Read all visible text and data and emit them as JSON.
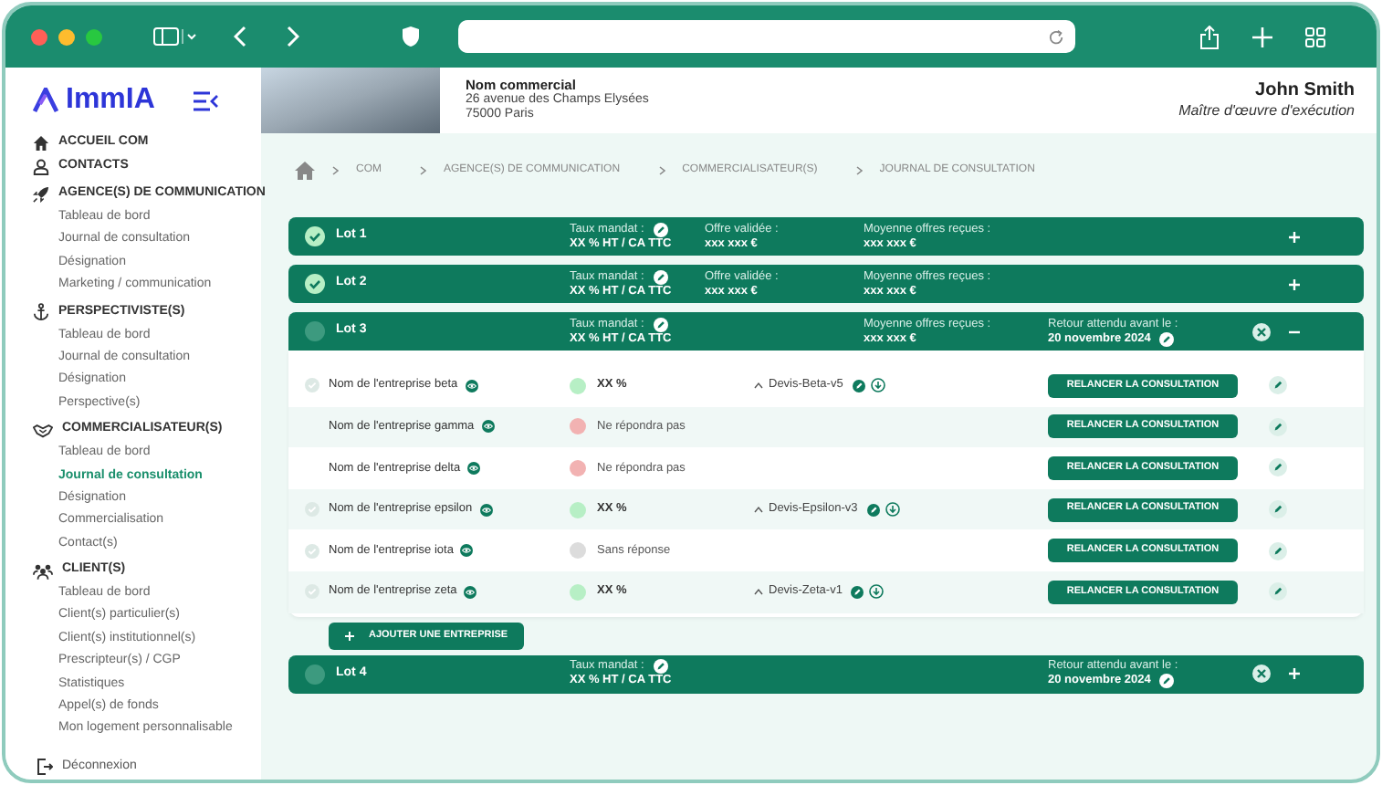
{
  "brand": {
    "name": "ImmIA"
  },
  "sidebar": {
    "sections": [
      {
        "kind": "home",
        "label": "ACCUEIL COM"
      },
      {
        "kind": "contacts",
        "label": "CONTACTS"
      },
      {
        "kind": "rocket",
        "label": "AGENCE(S) DE COMMUNICATION",
        "children": [
          {
            "label": "Tableau de bord",
            "selected": false
          },
          {
            "label": "Journal de consultation",
            "selected": false
          },
          {
            "label": "Désignation",
            "selected": false
          },
          {
            "label": "Marketing / communication",
            "selected": false
          }
        ]
      },
      {
        "kind": "anchor",
        "label": "PERSPECTIVISTE(S)",
        "children": [
          {
            "label": "Tableau de bord",
            "selected": false
          },
          {
            "label": "Journal de consultation",
            "selected": false
          },
          {
            "label": "Désignation",
            "selected": false
          },
          {
            "label": "Perspective(s)",
            "selected": false
          }
        ]
      },
      {
        "kind": "handshake",
        "label": "COMMERCIALISATEUR(S)",
        "children": [
          {
            "label": "Tableau de bord",
            "selected": false
          },
          {
            "label": "Journal de consultation",
            "selected": true
          },
          {
            "label": "Désignation",
            "selected": false
          },
          {
            "label": "Commercialisation",
            "selected": false
          },
          {
            "label": "Contact(s)",
            "selected": false
          }
        ]
      },
      {
        "kind": "people",
        "label": "CLIENT(S)",
        "children": [
          {
            "label": "Tableau de bord",
            "selected": false
          },
          {
            "label": "Client(s) particulier(s)",
            "selected": false
          },
          {
            "label": "Client(s) institutionnel(s)",
            "selected": false
          },
          {
            "label": "Prescripteur(s) / CGP",
            "selected": false
          },
          {
            "label": "Statistiques",
            "selected": false
          },
          {
            "label": "Appel(s) de fonds",
            "selected": false
          },
          {
            "label": "Mon logement personnalisable",
            "selected": false
          }
        ]
      }
    ],
    "logout": "Déconnexion"
  },
  "header": {
    "company": "Nom commercial",
    "address_lines": [
      "26 avenue des Champs Elysées",
      "75000 Paris"
    ],
    "user_name": "John Smith",
    "user_role": "Maître d'œuvre d'exécution"
  },
  "breadcrumb": [
    "COM",
    "AGENCE(S) DE COMMUNICATION",
    "COMMERCIALISATEUR(S)",
    "JOURNAL DE CONSULTATION"
  ],
  "lots": [
    {
      "name": "Lot 1",
      "completed": true,
      "expanded": false,
      "closable": false,
      "fields": {
        "taux_mandat": {
          "label": "Taux mandat :",
          "value": "XX % HT / CA TTC",
          "editable": true
        },
        "offre_validee": {
          "label": "Offre validée :",
          "value": "xxx xxx €",
          "editable": false
        },
        "moyenne_offres": {
          "label": "Moyenne offres reçues :",
          "value": "xxx xxx €",
          "editable": false
        }
      }
    },
    {
      "name": "Lot 2",
      "completed": true,
      "expanded": false,
      "closable": false,
      "fields": {
        "taux_mandat": {
          "label": "Taux mandat :",
          "value": "XX % HT / CA TTC",
          "editable": true
        },
        "offre_validee": {
          "label": "Offre validée :",
          "value": "xxx xxx €",
          "editable": false
        },
        "moyenne_offres": {
          "label": "Moyenne offres reçues :",
          "value": "xxx xxx €",
          "editable": false
        }
      }
    },
    {
      "name": "Lot 3",
      "completed": false,
      "expanded": true,
      "closable": true,
      "fields": {
        "taux_mandat": {
          "label": "Taux mandat :",
          "value": "XX % HT / CA TTC",
          "editable": true
        },
        "moyenne_offres": {
          "label": "Moyenne offres reçues :",
          "value": "xxx xxx €",
          "editable": false
        },
        "retour_attendu": {
          "label": "Retour attendu avant le :",
          "value": "20 novembre 2024",
          "editable": true
        }
      },
      "companies": [
        {
          "name": "Nom de l'entreprise beta",
          "checked": true,
          "status": {
            "kind": "percent",
            "text": "XX %",
            "color": "#b7efc5"
          },
          "quote": "Devis-Beta-v5",
          "action": "RELANCER LA CONSULTATION"
        },
        {
          "name": "Nom de l'entreprise gamma",
          "checked": false,
          "status": {
            "kind": "text",
            "text": "Ne répondra pas",
            "color": "#f2b2b2"
          },
          "action": "RELANCER LA CONSULTATION"
        },
        {
          "name": "Nom de l'entreprise delta",
          "checked": false,
          "status": {
            "kind": "text",
            "text": "Ne répondra pas",
            "color": "#f2b2b2"
          },
          "action": "RELANCER LA CONSULTATION"
        },
        {
          "name": "Nom de l'entreprise epsilon",
          "checked": true,
          "status": {
            "kind": "percent",
            "text": "XX %",
            "color": "#b7efc5"
          },
          "quote": "Devis-Epsilon-v3",
          "action": "RELANCER LA CONSULTATION"
        },
        {
          "name": "Nom de l'entreprise iota",
          "checked": true,
          "status": {
            "kind": "text",
            "text": "Sans réponse",
            "color": "#dcdcdc"
          },
          "action": "RELANCER LA CONSULTATION"
        },
        {
          "name": "Nom de l'entreprise zeta",
          "checked": true,
          "status": {
            "kind": "percent",
            "text": "XX %",
            "color": "#b7efc5"
          },
          "quote": "Devis-Zeta-v1",
          "action": "RELANCER LA CONSULTATION"
        }
      ],
      "add_button": "AJOUTER UNE ENTREPRISE"
    },
    {
      "name": "Lot 4",
      "completed": false,
      "expanded": false,
      "closable": true,
      "fields": {
        "taux_mandat": {
          "label": "Taux mandat :",
          "value": "XX % HT / CA TTC",
          "editable": true
        },
        "retour_attendu": {
          "label": "Retour attendu avant le :",
          "value": "20 novembre 2024",
          "editable": true
        }
      }
    }
  ]
}
